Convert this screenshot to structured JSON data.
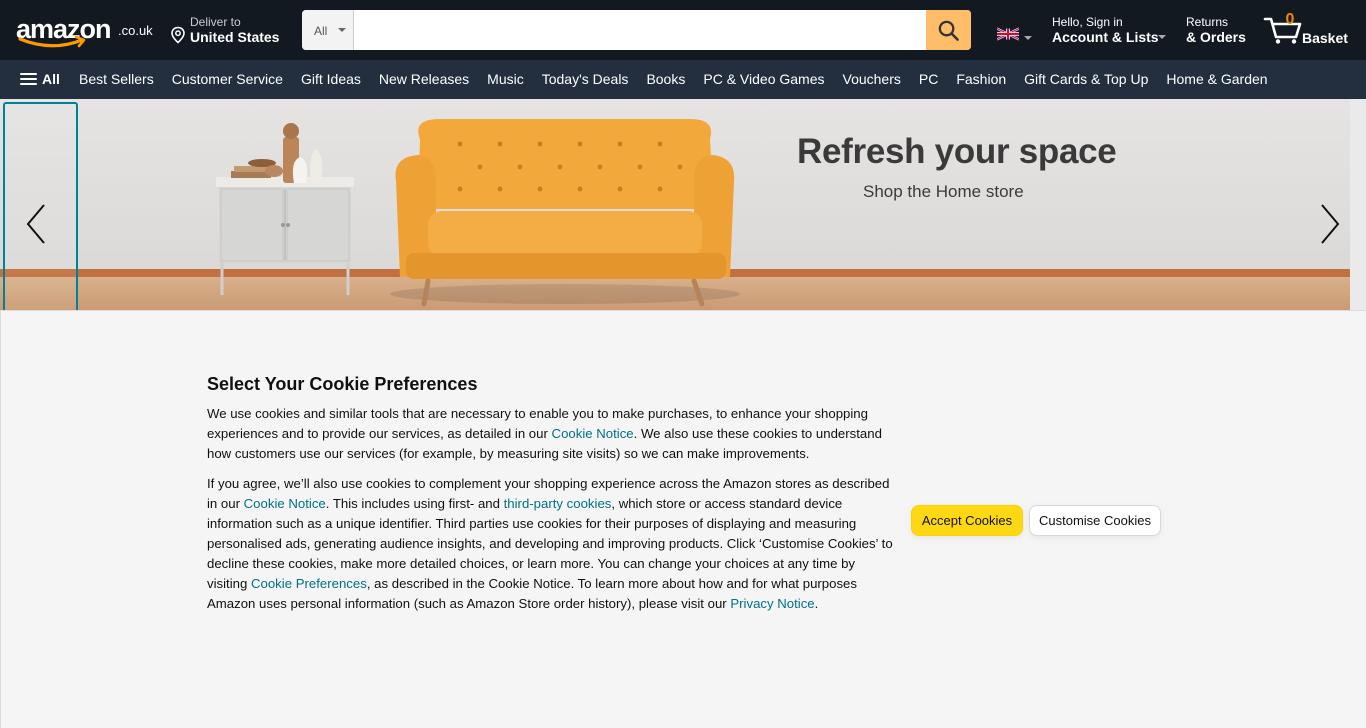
{
  "header": {
    "logo_text": "amazon",
    "logo_tld": ".co.uk",
    "deliver_line1": "Deliver to",
    "deliver_line2": "United States",
    "search_category": "All",
    "search_placeholder": "",
    "account_line1": "Hello, Sign in",
    "account_line2": "Account & Lists",
    "returns_line1": "Returns",
    "returns_line2": "& Orders",
    "basket_count": "0",
    "basket_label": "Basket"
  },
  "nav": {
    "all_label": "All",
    "links": [
      "Best Sellers",
      "Customer Service",
      "Gift Ideas",
      "New Releases",
      "Music",
      "Today's Deals",
      "Books",
      "PC & Video Games",
      "Vouchers",
      "PC",
      "Fashion",
      "Gift Cards & Top Up",
      "Home & Garden"
    ]
  },
  "hero": {
    "title": "Refresh your space",
    "subtitle": "Shop the Home store"
  },
  "cookie": {
    "title": "Select Your Cookie Preferences",
    "p1_a": "We use cookies and similar tools that are necessary to enable you to make purchases, to enhance your shopping experiences and to provide our services, as detailed in our ",
    "p1_link": "Cookie Notice",
    "p1_b": ". We also use these cookies to understand how customers use our services (for example, by measuring site visits) so we can make improvements.",
    "p2_a": "If you agree, we’ll also use cookies to complement your shopping experience across the Amazon stores as described in our ",
    "p2_link1": "Cookie Notice",
    "p2_b": ". This includes using first- and ",
    "p2_link2": "third-party cookies",
    "p2_c": ", which store or access standard device information such as a unique identifier. Third parties use cookies for their purposes of displaying and measuring personalised ads, generating audience insights, and developing and improving products. Click ‘Customise Cookies’ to decline these cookies, make more detailed choices, or learn more. You can change your choices at any time by visiting ",
    "p2_link3": "Cookie Preferences",
    "p2_d": ", as described in the Cookie Notice. To learn more about how and for what purposes Amazon uses personal information (such as Amazon Store order history), please visit our ",
    "p2_link4": "Privacy Notice",
    "p2_e": ".",
    "accept_label": "Accept Cookies",
    "customise_label": "Customise Cookies"
  },
  "colors": {
    "nav_dark": "#131921",
    "nav_secondary": "#232f3e",
    "search_button": "#febd69",
    "basket_count": "#f08804",
    "link": "#007185",
    "accept_button": "#ffd814"
  },
  "icons": {
    "location": "location-pin-icon",
    "search": "search-icon",
    "flag": "uk-flag-icon",
    "basket": "cart-icon",
    "menu": "hamburger-menu-icon",
    "carousel_prev": "chevron-left-icon",
    "carousel_next": "chevron-right-icon"
  }
}
